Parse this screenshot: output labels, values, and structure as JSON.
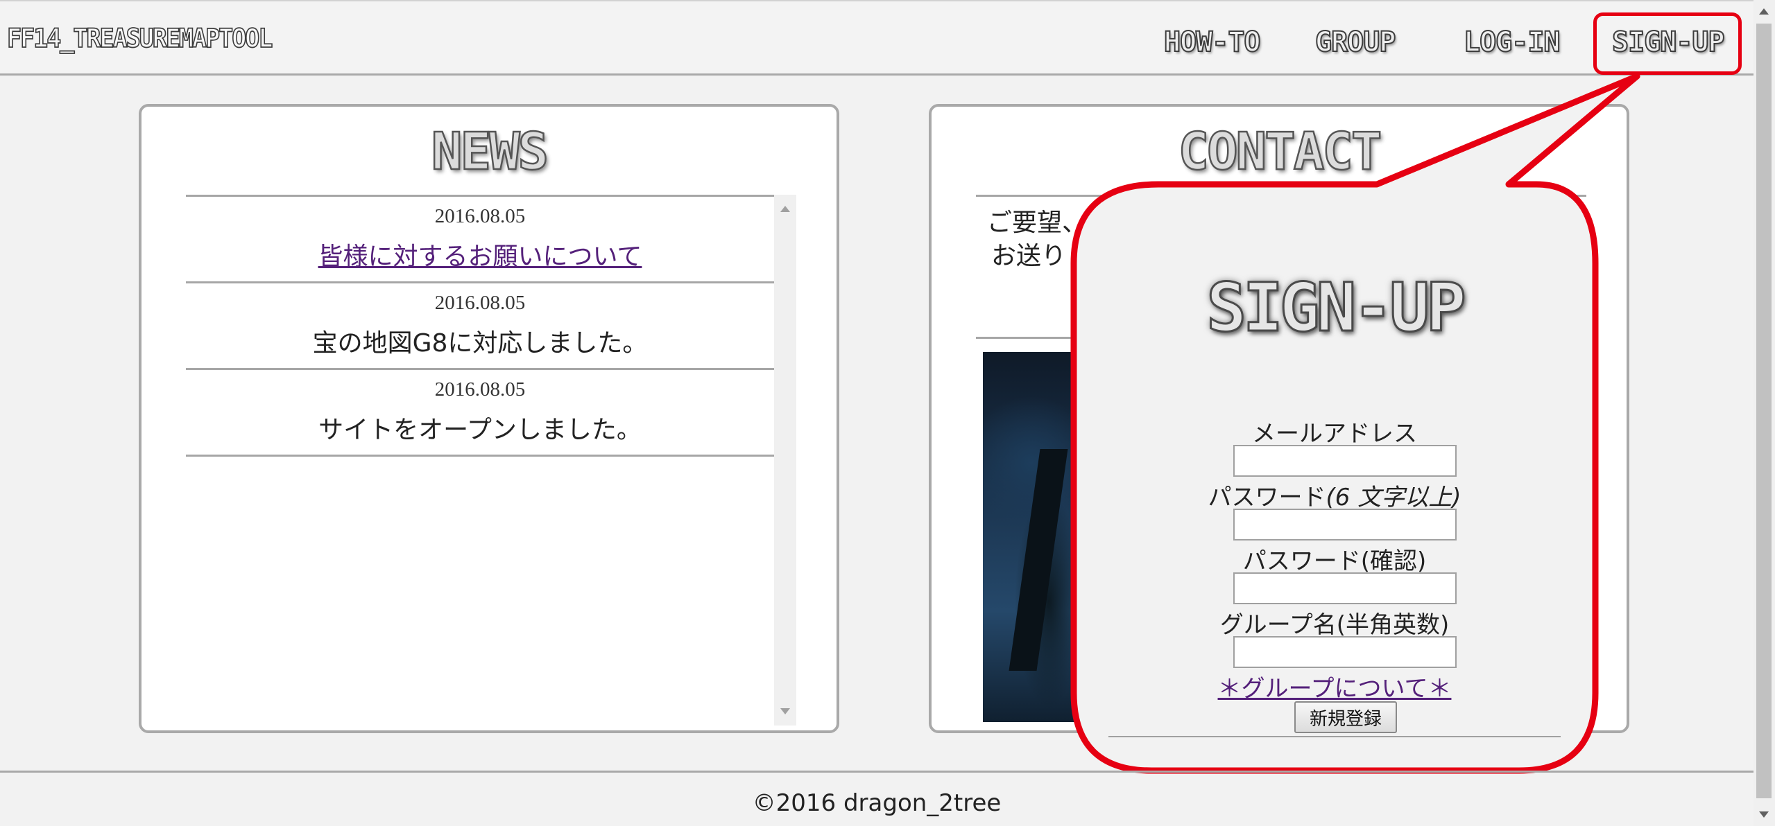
{
  "header": {
    "logo": "FF14_TREASUREMAPTOOL",
    "nav": {
      "howto": "HOW-TO",
      "group": "GROUP",
      "login": "LOG-IN",
      "signup": "SIGN-UP"
    }
  },
  "news": {
    "title": "NEWS",
    "items": [
      {
        "date": "2016.08.05",
        "text": "皆様に対するお願いについて"
      },
      {
        "date": "2016.08.05",
        "text": "宝の地図G8に対応しました。"
      },
      {
        "date": "2016.08.05",
        "text": "サイトをオープンしました。"
      }
    ]
  },
  "contact": {
    "title": "CONTACT",
    "line1": "ご要望、",
    "line2": "お送りく"
  },
  "signup": {
    "title": "SIGN-UP",
    "email_label": "メールアドレス",
    "password_label": "パスワード",
    "password_hint": "(6 文字以上)",
    "password_confirm_label": "パスワード(確認)",
    "group_label": "グループ名(半角英数)",
    "group_link": "＊グループについて＊",
    "submit": "新規登録"
  },
  "footer": {
    "copyright": "©2016 dragon_2tree"
  },
  "colors": {
    "highlight": "#e60012",
    "link": "#54207a"
  }
}
